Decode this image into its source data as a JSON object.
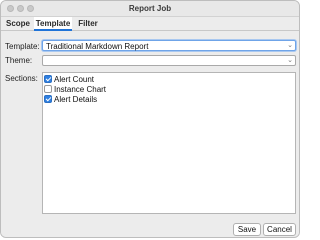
{
  "window": {
    "title": "Report Job"
  },
  "tabs": [
    {
      "label": "Scope",
      "active": false
    },
    {
      "label": "Template",
      "active": true
    },
    {
      "label": "Filter",
      "active": false
    }
  ],
  "form": {
    "template": {
      "label": "Template:",
      "value": "Traditional Markdown Report"
    },
    "theme": {
      "label": "Theme:",
      "value": ""
    },
    "sections": {
      "label": "Sections:",
      "items": [
        {
          "label": "Alert Count",
          "checked": true
        },
        {
          "label": "Instance Chart",
          "checked": false
        },
        {
          "label": "Alert Details",
          "checked": true
        }
      ]
    }
  },
  "footer": {
    "save_label": "Save",
    "cancel_label": "Cancel"
  },
  "colors": {
    "accent": "#1f73d8",
    "checkbox_checked": "#2f7fe0",
    "window_bg": "#ececec"
  }
}
